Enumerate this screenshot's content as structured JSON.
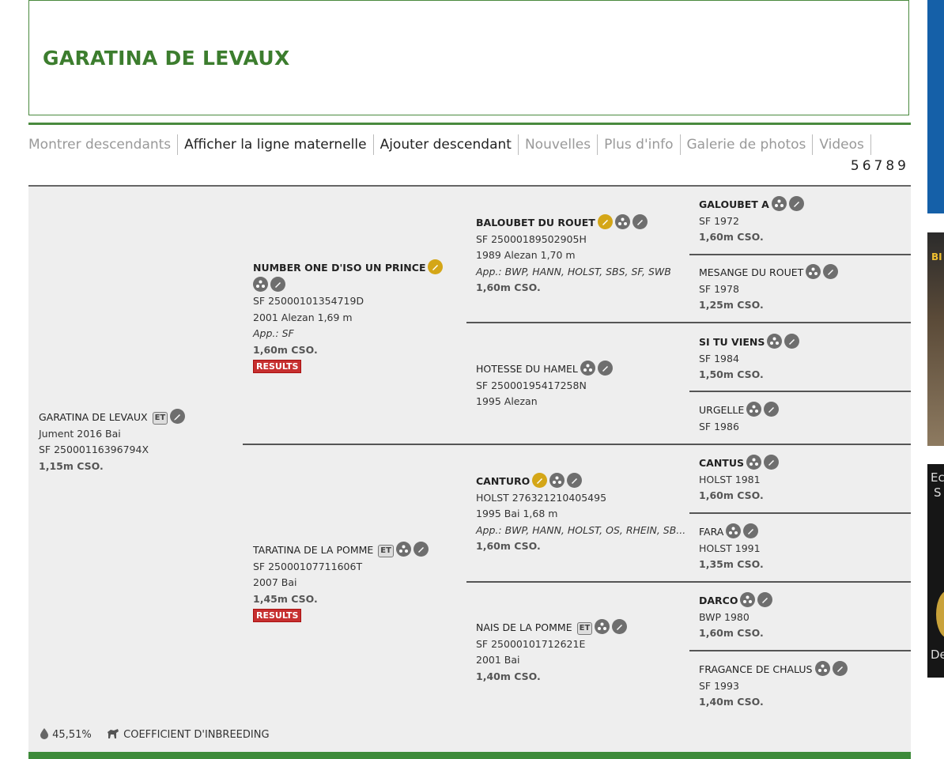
{
  "title": "GARATINA DE LEVAUX",
  "nav": [
    {
      "label": "Montrer descendants",
      "style": "dim"
    },
    {
      "label": "Afficher la ligne maternelle",
      "style": "dark"
    },
    {
      "label": "Ajouter descendant",
      "style": "dark"
    },
    {
      "label": "Nouvelles",
      "style": "dim"
    },
    {
      "label": "Plus d'info",
      "style": "dim"
    },
    {
      "label": "Galerie de photos",
      "style": "dim"
    },
    {
      "label": "Videos",
      "style": "dim"
    }
  ],
  "generations": [
    "5",
    "6",
    "7",
    "8",
    "9"
  ],
  "subject": {
    "name": "GARATINA DE LEVAUX",
    "badge": "ET",
    "line1": "Jument 2016 Bai",
    "line2": "SF 25000116396794X",
    "cso": "1,15m CSO."
  },
  "sire": {
    "name": "NUMBER ONE D'ISO UN PRINCE",
    "reg": "SF 25000101354719D",
    "info": "2001 Alezan 1,69 m",
    "app": "App.: SF",
    "cso": "1,60m CSO.",
    "results": "RESULTS"
  },
  "dam": {
    "name": "TARATINA DE LA POMME",
    "badge": "ET",
    "reg": "SF 25000107711606T",
    "info": "2007 Bai",
    "cso": "1,45m CSO.",
    "results": "RESULTS"
  },
  "gen3": {
    "ss": {
      "name": "BALOUBET DU ROUET",
      "reg": "SF 25000189502905H",
      "info": "1989 Alezan 1,70 m",
      "app": "App.: BWP, HANN, HOLST, SBS, SF, SWB",
      "cso": "1,60m CSO."
    },
    "sd": {
      "name": "HOTESSE DU HAMEL",
      "reg": "SF 25000195417258N",
      "info": "1995 Alezan"
    },
    "ds": {
      "name": "CANTURO",
      "reg": "HOLST 276321210405495",
      "info": "1995 Bai 1,68 m",
      "app": "App.: BWP, HANN, HOLST, OS, RHEIN, SB...",
      "cso": "1,60m CSO."
    },
    "dd": {
      "name": "NAIS DE LA POMME",
      "badge": "ET",
      "reg": "SF 25000101712621E",
      "info": "2001 Bai",
      "cso": "1,40m CSO."
    }
  },
  "gen4": [
    {
      "name": "GALOUBET A",
      "info": "SF 1972",
      "cso": "1,60m CSO."
    },
    {
      "name": "MESANGE DU ROUET",
      "info": "SF 1978",
      "cso": "1,25m CSO."
    },
    {
      "name": "SI TU VIENS",
      "info": "SF 1984",
      "cso": "1,50m CSO."
    },
    {
      "name": "URGELLE",
      "info": "SF 1986",
      "cso": ""
    },
    {
      "name": "CANTUS",
      "info": "HOLST 1981",
      "cso": "1,60m CSO."
    },
    {
      "name": "FARA",
      "info": "HOLST 1991",
      "cso": "1,35m CSO."
    },
    {
      "name": "DARCO",
      "info": "BWP 1980",
      "cso": "1,60m CSO."
    },
    {
      "name": "FRAGANCE DE CHALUS",
      "info": "SF 1993",
      "cso": "1,40m CSO."
    }
  ],
  "footer": {
    "blood": "45,51%",
    "inbreeding": "COEFFICIENT D'INBREEDING"
  },
  "ads": {
    "a2_text": "BI",
    "a3_t1": "Ec",
    "a3_t2": "S",
    "a3_t3": "De"
  },
  "colors": {
    "brand_green": "#3c7d2e",
    "icon_grey": "#6e6e6e",
    "icon_gold": "#d4a617",
    "results_red": "#c62f2f"
  }
}
